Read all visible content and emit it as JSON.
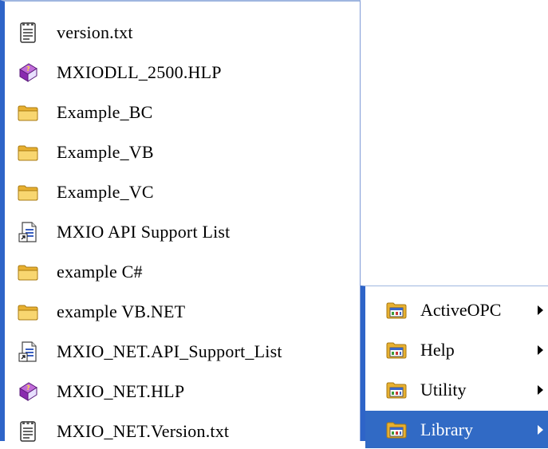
{
  "left_menu": {
    "items": [
      {
        "label": "version.txt",
        "icon": "text-file-icon"
      },
      {
        "label": "MXIODLL_2500.HLP",
        "icon": "help-book-icon"
      },
      {
        "label": "Example_BC",
        "icon": "folder-icon"
      },
      {
        "label": "Example_VB",
        "icon": "folder-icon"
      },
      {
        "label": "Example_VC",
        "icon": "folder-icon"
      },
      {
        "label": "MXIO API Support List",
        "icon": "document-shortcut-icon"
      },
      {
        "label": "example C#",
        "icon": "folder-icon"
      },
      {
        "label": "example VB.NET",
        "icon": "folder-icon"
      },
      {
        "label": "MXIO_NET.API_Support_List",
        "icon": "document-shortcut-icon"
      },
      {
        "label": "MXIO_NET.HLP",
        "icon": "help-book-icon"
      },
      {
        "label": "MXIO_NET.Version.txt",
        "icon": "text-file-icon"
      }
    ]
  },
  "right_menu": {
    "items": [
      {
        "label": "ActiveOPC",
        "icon": "program-folder-icon",
        "selected": false
      },
      {
        "label": "Help",
        "icon": "program-folder-icon",
        "selected": false
      },
      {
        "label": "Utility",
        "icon": "program-folder-icon",
        "selected": false
      },
      {
        "label": "Library",
        "icon": "program-folder-icon",
        "selected": true
      }
    ]
  },
  "colors": {
    "menu_accent": "#2e64c8",
    "selection": "#316ac5",
    "folder": "#f2c24d"
  }
}
